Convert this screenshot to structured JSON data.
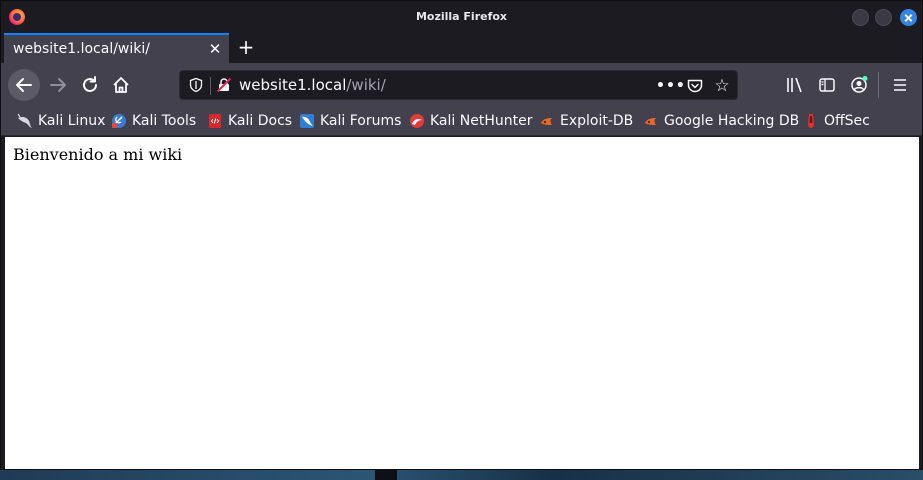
{
  "window": {
    "title": "Mozilla Firefox"
  },
  "tabs": [
    {
      "label": "website1.local/wiki/",
      "active": true
    }
  ],
  "newtab_label": "+",
  "urlbar": {
    "host": "website1.local",
    "path": "/wiki/"
  },
  "bookmarks": [
    {
      "label": "Kali Linux",
      "icon": "kali-dragon-icon"
    },
    {
      "label": "Kali Tools",
      "icon": "kali-tools-icon"
    },
    {
      "label": "Kali Docs",
      "icon": "kali-docs-icon"
    },
    {
      "label": "Kali Forums",
      "icon": "kali-forums-icon"
    },
    {
      "label": "Kali NetHunter",
      "icon": "nethunter-icon"
    },
    {
      "label": "Exploit-DB",
      "icon": "exploit-db-icon"
    },
    {
      "label": "Google Hacking DB",
      "icon": "ghdb-icon"
    },
    {
      "label": "OffSec",
      "icon": "offsec-icon"
    }
  ],
  "page": {
    "text": "Bienvenido a mi wiki"
  },
  "colors": {
    "accent": "#0a84ff",
    "toolbar": "#42414d",
    "frame": "#1c1b22",
    "close_button": "#3584e4"
  }
}
